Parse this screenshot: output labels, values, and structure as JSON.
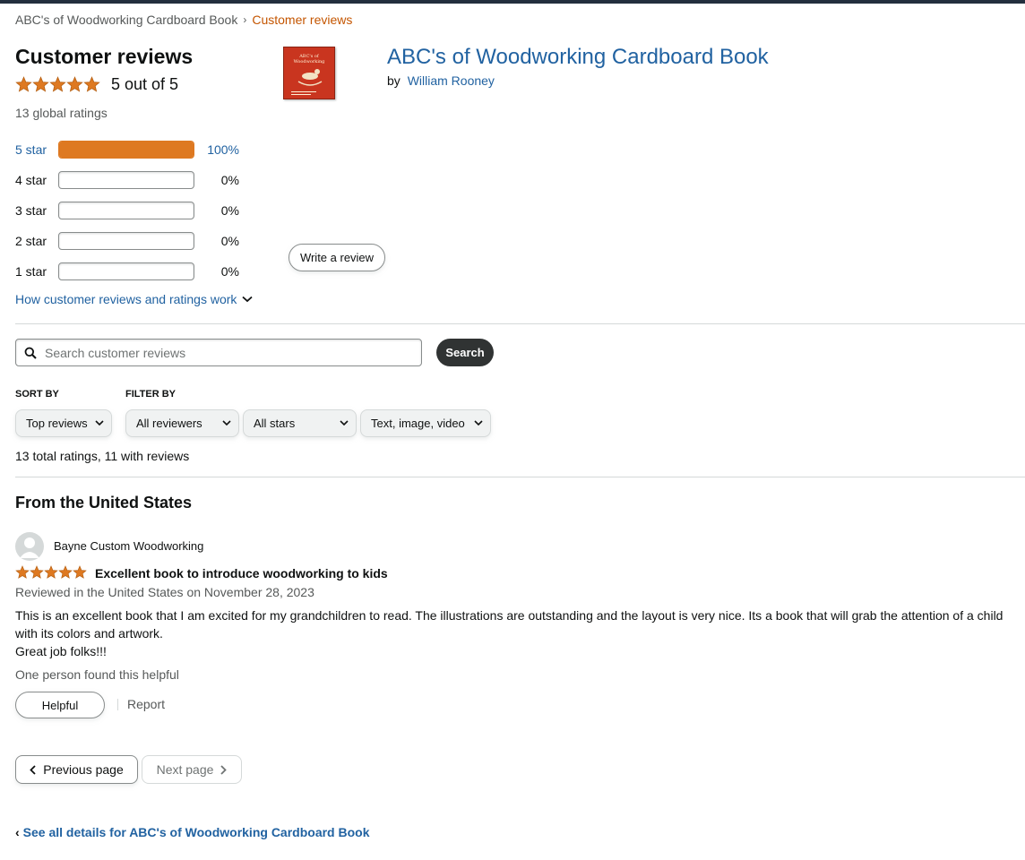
{
  "breadcrumb": {
    "parent": "ABC's of Woodworking Cardboard Book",
    "separator": "›",
    "current": "Customer reviews"
  },
  "summary": {
    "heading": "Customer reviews",
    "rating_text": "5 out of 5",
    "rating_value": 5,
    "global_ratings": "13 global ratings",
    "histogram": [
      {
        "label": "5 star",
        "percent": "100%",
        "fill": 1.0
      },
      {
        "label": "4 star",
        "percent": "0%",
        "fill": 0
      },
      {
        "label": "3 star",
        "percent": "0%",
        "fill": 0
      },
      {
        "label": "2 star",
        "percent": "0%",
        "fill": 0
      },
      {
        "label": "1 star",
        "percent": "0%",
        "fill": 0
      }
    ],
    "how_link": "How customer reviews and ratings work"
  },
  "product": {
    "title": "ABC's of Woodworking Cardboard Book",
    "by": "by",
    "author": "William Rooney",
    "cover_title_line1": "ABC's of",
    "cover_title_line2": "Woodworking",
    "cover_color": "#c9351f"
  },
  "write_review_label": "Write a review",
  "search": {
    "placeholder": "Search customer reviews",
    "button": "Search"
  },
  "sort": {
    "label": "SORT BY",
    "value": "Top reviews"
  },
  "filter": {
    "label": "FILTER BY",
    "reviewers": "All reviewers",
    "stars": "All stars",
    "media": "Text, image, video"
  },
  "totals": "13 total ratings, 11 with reviews",
  "region_heading": "From the United States",
  "reviews": [
    {
      "reviewer": "Bayne Custom Woodworking",
      "stars": 5,
      "title": "Excellent book to introduce woodworking to kids",
      "date": "Reviewed in the United States on November 28, 2023",
      "body_line1": "This is an excellent book that I am excited for my grandchildren to read. The illustrations are outstanding and the layout is very nice. Its a book that will grab the attention of a child with its colors and artwork.",
      "body_line2": "Great job folks!!!",
      "helpful_count": "One person found this helpful",
      "helpful_button": "Helpful",
      "report": "Report"
    }
  ],
  "pagination": {
    "previous": "Previous page",
    "next": "Next page"
  },
  "see_all": {
    "chevron": "‹",
    "text": "See all details for ABC's of Woodworking Cardboard Book"
  },
  "colors": {
    "star": "#de7921",
    "link": "#2162a1",
    "breadcrumb_current": "#c45500"
  },
  "icons": [
    "star-icon",
    "chevron-down-icon",
    "search-icon",
    "avatar-icon",
    "chevron-left-icon",
    "chevron-right-icon"
  ]
}
